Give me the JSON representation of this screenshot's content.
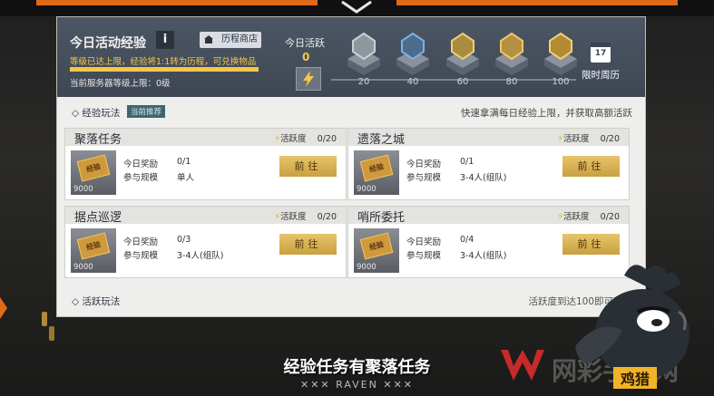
{
  "header": {
    "title": "今日活动经验",
    "info_glyph": "i",
    "shop_label": "历程商店",
    "desc": "等级已达上限，经验将1:1转为历程，可兑换物品",
    "progress": 1.0,
    "server_text": "当前服务器等级上限：0级"
  },
  "activity": {
    "label": "今日活跃",
    "value": "0",
    "rewards": [
      {
        "threshold": "20",
        "icon": "silver-gear-crate-icon"
      },
      {
        "threshold": "40",
        "icon": "blue-bolt-crate-icon"
      },
      {
        "threshold": "60",
        "icon": "gold-badge-crate-icon"
      },
      {
        "threshold": "80",
        "icon": "gold-coin-crate-icon"
      },
      {
        "threshold": "100",
        "icon": "gold-weapon-crate-icon"
      }
    ],
    "calendar_day": "17",
    "calendar_label": "限时周历"
  },
  "exp_section": {
    "title": "经验玩法",
    "tag": "当前推荐",
    "hint": "快速拿满每日经验上限，并获取高额活跃"
  },
  "tasks": [
    {
      "name": "聚落任务",
      "activity_label": "活跃度",
      "activity_value": "0/20",
      "reward_key": "今日奖励",
      "reward_value": "0/1",
      "size_key": "参与规模",
      "size_value": "单人",
      "button": "前往",
      "ticket": "经验",
      "count": "9000"
    },
    {
      "name": "遗落之城",
      "activity_label": "活跃度",
      "activity_value": "0/20",
      "reward_key": "今日奖励",
      "reward_value": "0/1",
      "size_key": "参与规模",
      "size_value": "3-4人(组队)",
      "button": "前往",
      "ticket": "经验",
      "count": "9000"
    },
    {
      "name": "据点巡逻",
      "activity_label": "活跃度",
      "activity_value": "0/20",
      "reward_key": "今日奖励",
      "reward_value": "0/3",
      "size_key": "参与规模",
      "size_value": "3-4人(组队)",
      "button": "前往",
      "ticket": "经验",
      "count": "9000"
    },
    {
      "name": "哨所委托",
      "activity_label": "活跃度",
      "activity_value": "0/20",
      "reward_key": "今日奖励",
      "reward_value": "0/4",
      "size_key": "参与规模",
      "size_value": "3-4人(组队)",
      "button": "前往",
      "ticket": "经验",
      "count": "9000"
    }
  ],
  "active_section": {
    "title": "活跃玩法",
    "hint": "活跃度到达100即可获得"
  },
  "subtitle": "经验任务有聚落任务",
  "raven": "✕✕✕  RAVEN  ✕✕✕",
  "watermark": {
    "text": "网彩手游网",
    "tag": "鸡猎"
  },
  "colors": {
    "accent_orange": "#e06a1a",
    "gold": "#f3c84a",
    "header_bg": "#465060"
  }
}
